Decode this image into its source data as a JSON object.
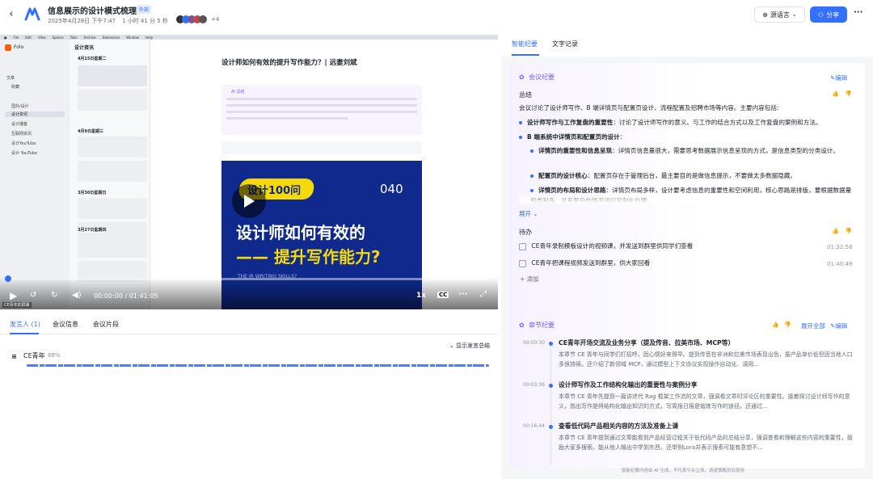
{
  "header": {
    "title": "信息展示的设计模式梳理",
    "badge": "外部",
    "meta_date": "2025年4月28日 下午7:47",
    "meta_duration": "1 小时 41 分 5 秒",
    "participants_more": "+4",
    "lang_button": "源语言",
    "share_button": "分享",
    "more_button": "···"
  },
  "browser": {
    "app_name": "Folo",
    "menu": [
      "File",
      "Edit",
      "View",
      "Spaces",
      "Tabs",
      "Archive",
      "Extensions",
      "Window",
      "Help"
    ],
    "feed_title": "设计资讯",
    "sidebar_items": [
      "文章",
      "收藏",
      "国外/设计",
      "设计资讯",
      "设计播客",
      "互联网资讯",
      "设计YouTube",
      "设计 YouTube"
    ],
    "groups": [
      "4月15日星期二",
      "4月9日星期三",
      "3月30日星期日",
      "3月27日星期四"
    ],
    "article_title": "设计师如何有效的提升写作能力？| 远妻刘斌",
    "ai_label": "AI 总结",
    "video_tag": "设计100问",
    "video_num": "040",
    "video_line1": "设计师如何有效的",
    "video_line2": "—— 提升写作能力?",
    "video_sub": "THE IR WRITING SKILLS?",
    "corner_label": "CE青年的屏幕"
  },
  "player": {
    "time": "00:00:00 / 01:41:05",
    "speed": "1x",
    "progress": 0.0
  },
  "left_tabs": [
    "发言人 (1)",
    "会议信息",
    "会议片段"
  ],
  "speaker": {
    "toggle_label": "显示发言总结",
    "name": "CE青年",
    "percent": "88%"
  },
  "right_tabs": [
    "智能纪要",
    "文字记录"
  ],
  "summary": {
    "section": "会议纪要",
    "edit": "编辑",
    "label": "总结",
    "intro": "会议讨论了设计师写作、B 端详情页与配置页设计、流程配置及招聘市场等内容。主要内容包括:",
    "bullets": [
      {
        "bold": "设计师写作与工作复盘的重要性",
        "text": "：讨论了设计师写作的意义、与工作的结合方式以及工作复盘的案例和方法。"
      },
      {
        "bold": "B 端系统中详情页和配置页的设计",
        "text": "："
      }
    ],
    "sub_bullets": [
      {
        "bold": "详情页的重要性和信息呈现",
        "text": "：详情页信息量很大，需要思考数据展示信息呈现的方式，是信息类型的分类设计。"
      },
      {
        "bold": "配置页的设计核心",
        "text": "：配置页存在于管理后台，最主要目的是做信息提示，不要做太多数据隐藏。"
      },
      {
        "bold": "详情页的布局和设计思路",
        "text": "：详情页布局多样，设计要考虑信息的重要性和空间利用，核心思路是排版，要根据数据量和类别多、关系复杂的情况进行定制化处理。"
      }
    ],
    "expand": "展开",
    "todo_label": "待办",
    "todos": [
      {
        "text": "CE青年录制模板设计的视频课，并发送到群里供同学们查看",
        "time": "01:32:58"
      },
      {
        "text": "CE青年把课程视频发送到群里，供大家回看",
        "time": "01:40:49"
      }
    ],
    "add": "添加"
  },
  "chapters": {
    "section": "章节纪要",
    "expand_all": "展开全部",
    "edit": "编辑",
    "items": [
      {
        "time": "00:00:30",
        "title": "CE青年开场交流及业务分享（提及传音、拉美市场、MCP等）",
        "body": "本章节 CE 青年与同学们打招呼，因心情好来得早。提到传音在非洲和拉美市场表现出色，虽产品单价低但因当地人口多很持续。还介绍了新领域 MCP，通过模型上下文协议实现操作自动化、调用..."
      },
      {
        "time": "00:03:36",
        "title": "设计师写作及工作结构化输出的重要性与案例分享",
        "body": "本章节 CE 青年先提到一篇讲述代 Rag 框架工作流的文章，强调看文章时评论区的重要性。接着探讨设计师写作的意义，指出写作是将结构化输出知识的方式，写周报日报是锻炼写作的途径。还通过..."
      },
      {
        "time": "00:16:44",
        "title": "查看低代码产品相关内容的方法及准备上课",
        "body": "本章节 CE 青年提到通过文章能看到产品经营过程关于低代码产品的总结分享，强调查看和理解这些内容的重要性，鼓励大家多搜索。能从他人输出中学到东西，还举例Lora并表示搜索可能有意想不..."
      }
    ],
    "footer": "智能纪要内容由 AI 生成，不代表平台立场，请谨慎甄别后使用"
  },
  "colors": {
    "accent": "#3370ff",
    "video_yellow": "#f5d90a",
    "video_bg": "#0f2a8c"
  }
}
